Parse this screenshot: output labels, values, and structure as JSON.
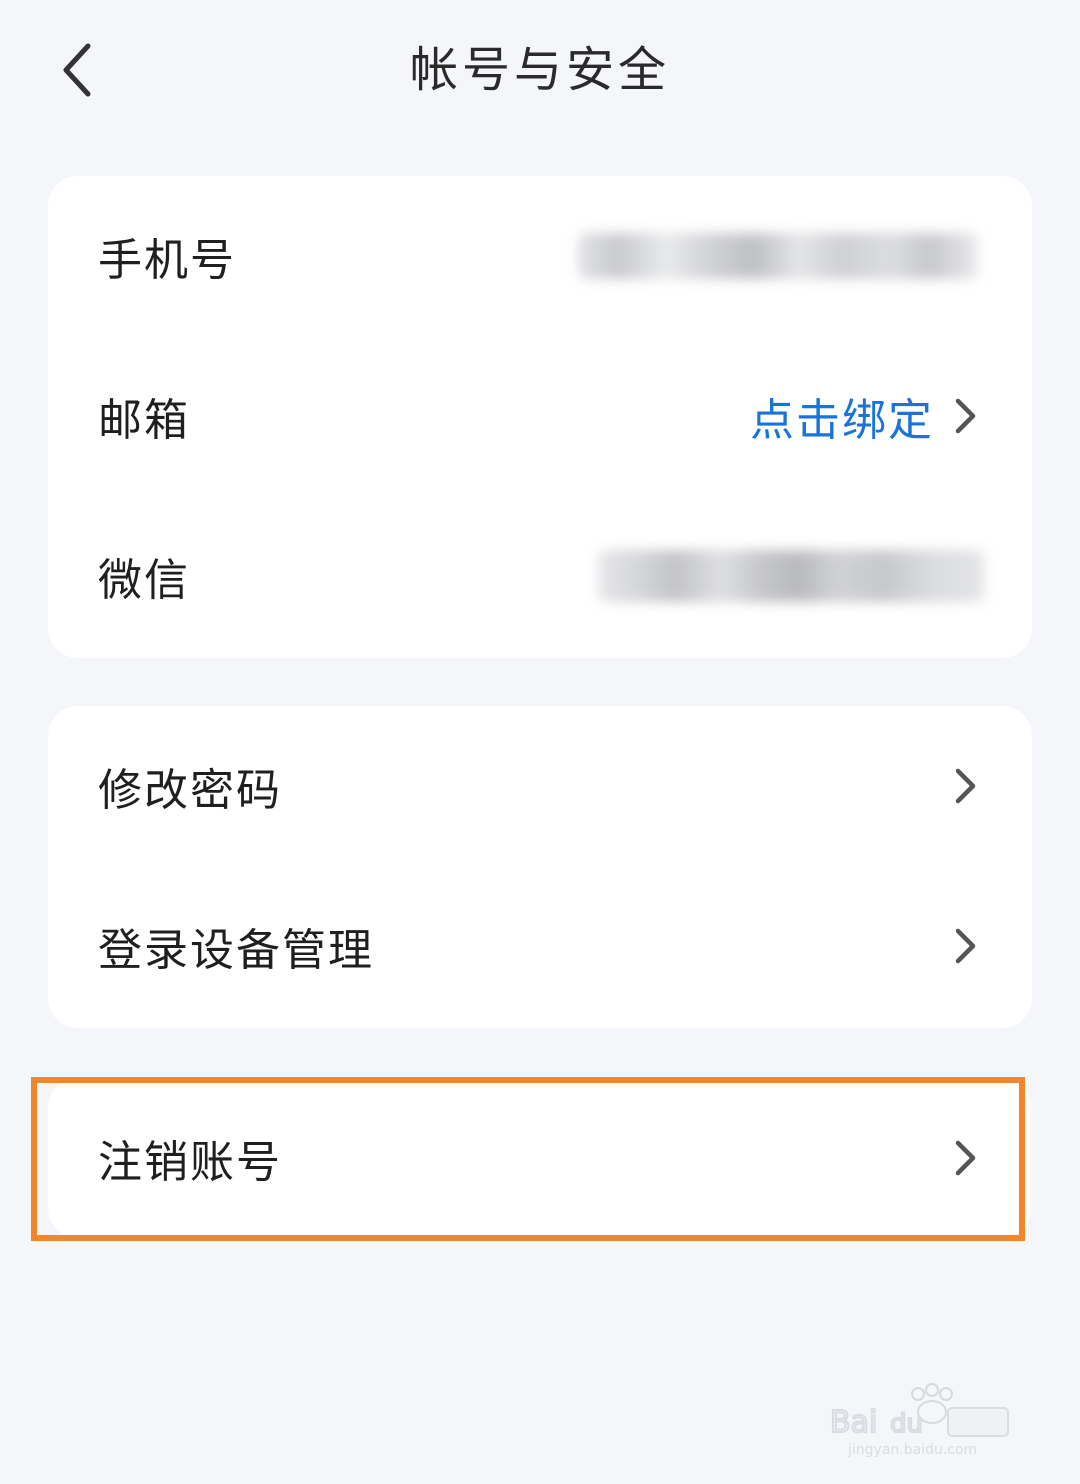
{
  "header": {
    "back_icon": "chevron-left-icon",
    "title": "帐号与安全"
  },
  "account_card": {
    "phone": {
      "label": "手机号",
      "value_state": "redacted (blurred)"
    },
    "email": {
      "label": "邮箱",
      "action": "点击绑定"
    },
    "wechat": {
      "label": "微信",
      "value_state": "redacted (blurred)"
    }
  },
  "security_card": {
    "change_password": {
      "label": "修改密码"
    },
    "device_management": {
      "label": "登录设备管理"
    }
  },
  "delete_card": {
    "delete_account": {
      "label": "注销账号"
    }
  },
  "chevron_icon": "chevron-right-icon",
  "colors": {
    "background": "#f5f6fa",
    "card": "#ffffff",
    "link": "#1a73d9",
    "highlight": "#f5852b",
    "chevron": "#555555"
  }
}
